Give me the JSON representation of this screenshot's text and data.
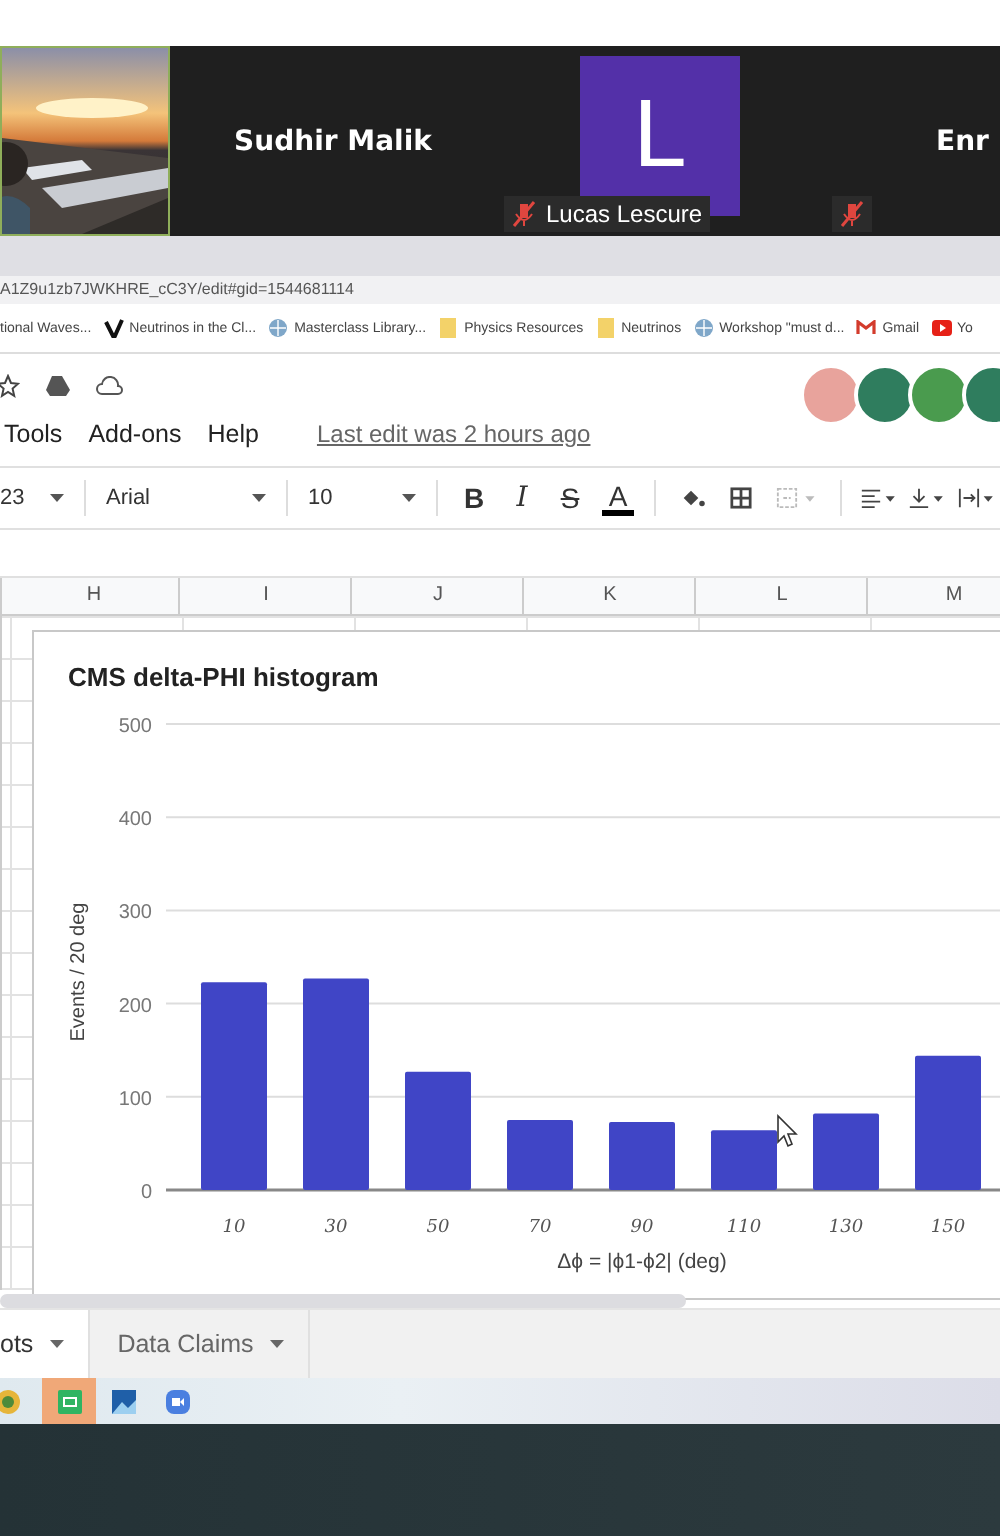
{
  "participants": [
    {
      "kind": "video"
    },
    {
      "kind": "name",
      "name": "Sudhir Malik",
      "muted": false
    },
    {
      "kind": "avatar",
      "initial": "L",
      "name": "Lucas Lescure",
      "muted": true
    },
    {
      "kind": "name",
      "name": "Enr",
      "muted": true
    }
  ],
  "browser": {
    "url": "A1Z9u1zb7JWKHRE_cC3Y/edit#gid=1544681114",
    "bookmarks": [
      {
        "kind": "plain",
        "label": "tional Waves..."
      },
      {
        "kind": "logo",
        "label": "Neutrinos in the Cl..."
      },
      {
        "kind": "globe",
        "label": "Masterclass Library..."
      },
      {
        "kind": "folder",
        "label": "Physics Resources"
      },
      {
        "kind": "folder",
        "label": "Neutrinos"
      },
      {
        "kind": "globe",
        "label": "Workshop \"must d..."
      },
      {
        "kind": "mail",
        "label": "Gmail"
      },
      {
        "kind": "video",
        "label": "Yo"
      }
    ]
  },
  "sheets": {
    "menu": [
      "Tools",
      "Add-ons",
      "Help"
    ],
    "last_edit": "Last edit was 2 hours ago",
    "collaborators": [
      {
        "color": "#e8a39c"
      },
      {
        "color": "#2f7d5e"
      },
      {
        "color": "#4a9b4e"
      },
      {
        "color": "#2f7d5e"
      }
    ],
    "zoom": "23",
    "font": "Arial",
    "font_size": "10",
    "format_buttons": [
      {
        "kind": "bold",
        "label": "B"
      },
      {
        "kind": "italic",
        "label": "I"
      },
      {
        "kind": "strike",
        "label": "S"
      },
      {
        "kind": "color",
        "label": "A"
      }
    ],
    "columns": [
      "H",
      "I",
      "J",
      "K",
      "L",
      "M"
    ],
    "chart_data": {
      "type": "bar",
      "title": "CMS delta-PHI histogram",
      "xlabel": "Δϕ = |ϕ1-ϕ2| (deg)",
      "ylabel": "Events / 20 deg",
      "categories": [
        "10",
        "30",
        "50",
        "70",
        "90",
        "110",
        "130",
        "150"
      ],
      "series": [
        {
          "color": "#4045c6",
          "values": [
            223,
            227,
            127,
            75,
            73,
            64,
            82,
            144
          ]
        }
      ],
      "grid": true,
      "ylim": [
        0,
        500
      ],
      "yticks": [
        0,
        100,
        200,
        300,
        400,
        500
      ]
    },
    "tabs": [
      {
        "label": "ots",
        "selected": true
      },
      {
        "label": "Data Claims",
        "selected": false
      }
    ]
  },
  "taskbar": [
    {
      "kind": "browser",
      "selected": false
    },
    {
      "kind": "sheets",
      "selected": true
    },
    {
      "kind": "photos",
      "selected": false
    },
    {
      "kind": "meeting",
      "selected": false
    }
  ]
}
